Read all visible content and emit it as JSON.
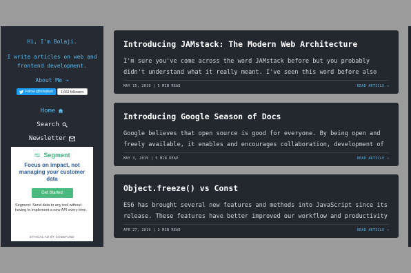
{
  "sidebar": {
    "greeting": "Hi, I'm Bolaji.",
    "bio": "I write articles on web and frontend development.",
    "about_link": "About Me →",
    "twitter_button": "Follow @bolajiayo",
    "followers": "1,662 followers",
    "nav": [
      {
        "label": "Home",
        "icon": "home-icon"
      },
      {
        "label": "Search",
        "icon": "search-icon"
      },
      {
        "label": "Newsletter",
        "icon": "mail-icon"
      }
    ]
  },
  "ad": {
    "brand": "Segment",
    "headline": "Focus on impact, not managing your customer data",
    "button": "Get Started",
    "body": "Segment: Send data to any tool without having to implement a new API every time.",
    "footer": "ETHICAL AD BY CODEFUND"
  },
  "articles": [
    {
      "title": "Introducing JAMstack: The Modern Web Architecture",
      "excerpt": "I'm sure you've come across the word JAMstack before but you probably didn't understand what it really meant. I've seen this word before also but didn't",
      "date": "MAY 15, 2019",
      "read_time": "5 MIN READ",
      "read_link": "READ ARTICLE →"
    },
    {
      "title": "Introducing Google Season of Docs",
      "excerpt": "Google believes that open source is good for everyone. By being open and freely available, it enables and encourages collaboration, development of",
      "date": "MAY 3, 2019",
      "read_time": "5 MIN READ",
      "read_link": "READ ARTICLE →"
    },
    {
      "title": "Object.freeze() vs Const",
      "excerpt": "ES6 has brought several new features and methods into JavaScript since its release. These features have better improved our workflow and productivity",
      "date": "APR 27, 2019",
      "read_time": "3 MIN READ",
      "read_link": "READ ARTICLE →"
    }
  ]
}
